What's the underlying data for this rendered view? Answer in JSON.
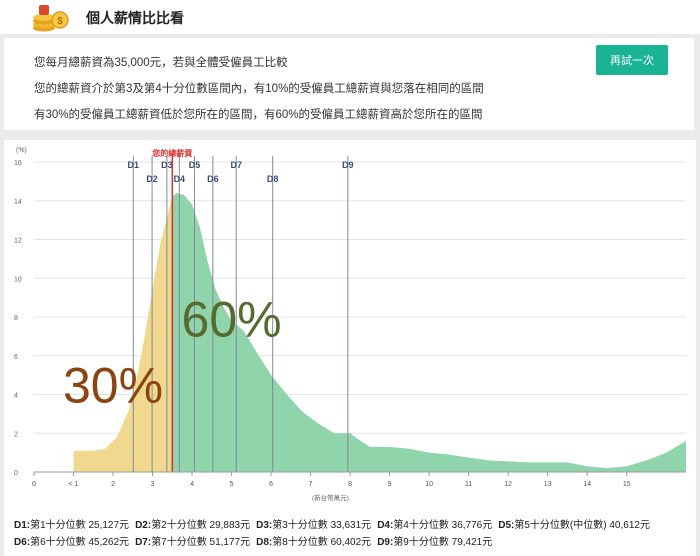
{
  "header": {
    "title": "個人薪情比比看"
  },
  "info": {
    "line1": "您每月總薪資為35,000元，若與全體受僱員工比較",
    "line2": "您的總薪資介於第3及第4十分位數區間內，有10%的受僱員工總薪資與您落在相同的區間",
    "line3": "有30%的受僱員工總薪資低於您所在的區間，有60%的受僱員工總薪資高於您所在的區間",
    "retry_label": "再試一次"
  },
  "chart_data": {
    "type": "area",
    "y_unit_label": "(%)",
    "x_unit_label": "(新台幣萬元)",
    "xlim": [
      0,
      16.5
    ],
    "ylim": [
      0,
      16
    ],
    "x_tick_labels": [
      "0",
      "< 1",
      "2",
      "3",
      "4",
      "5",
      "6",
      "7",
      "8",
      "9",
      "10",
      "11",
      "12",
      "13",
      "14",
      "15"
    ],
    "y_ticks": [
      0,
      2,
      4,
      6,
      8,
      10,
      12,
      14,
      16
    ],
    "grid": true,
    "series": [
      {
        "x": [
          1.0,
          1.5,
          1.8,
          2.1,
          2.4,
          2.6,
          2.8,
          3.0,
          3.2,
          3.35,
          3.5,
          3.6,
          3.8,
          4.0,
          4.2,
          4.4,
          4.6,
          4.8,
          5.0,
          5.3,
          5.6,
          6.0,
          6.4,
          6.8,
          7.2,
          7.6,
          7.8,
          8.0,
          8.2,
          8.5,
          9.0,
          9.5,
          10.0,
          10.5,
          11.0,
          11.5,
          12.0,
          12.5,
          13.0,
          13.5,
          14.0,
          14.5,
          15.0,
          15.5,
          16.0,
          16.5
        ],
        "y": [
          1.1,
          1.1,
          1.2,
          1.8,
          3.2,
          4.8,
          7.0,
          9.5,
          11.8,
          13.0,
          14.2,
          14.4,
          14.3,
          13.8,
          12.6,
          10.8,
          9.4,
          8.5,
          7.8,
          7.3,
          6.3,
          5.0,
          4.0,
          3.1,
          2.5,
          2.0,
          2.0,
          2.0,
          1.7,
          1.3,
          1.3,
          1.2,
          1.0,
          0.9,
          0.75,
          0.6,
          0.55,
          0.5,
          0.5,
          0.5,
          0.3,
          0.2,
          0.3,
          0.6,
          1.0,
          1.6
        ]
      }
    ],
    "split_x": 3.5,
    "user_salary_x": 3.5,
    "user_salary_label": "您的總薪資",
    "deciles": [
      {
        "label": "D1",
        "x": 2.5127
      },
      {
        "label": "D2",
        "x": 2.9883
      },
      {
        "label": "D3",
        "x": 3.3631
      },
      {
        "label": "D4",
        "x": 3.6776
      },
      {
        "label": "D5",
        "x": 4.0612
      },
      {
        "label": "D6",
        "x": 4.5262
      },
      {
        "label": "D7",
        "x": 5.1177
      },
      {
        "label": "D8",
        "x": 6.0402
      },
      {
        "label": "D9",
        "x": 7.9421
      }
    ],
    "annotations": [
      {
        "text": "30%",
        "color": "#8b4513"
      },
      {
        "text": "60%",
        "color": "#556b2f"
      }
    ],
    "colors": {
      "lower": "#f0d98e",
      "upper": "#8fd4ab",
      "line": "#7d8b99",
      "user": "#e0302a"
    }
  },
  "legend": {
    "row1": [
      {
        "key": "D1:",
        "text": "第1十分位數 25,127元"
      },
      {
        "key": "D2:",
        "text": "第2十分位數 29,883元"
      },
      {
        "key": "D3:",
        "text": "第3十分位數 33,631元"
      },
      {
        "key": "D4:",
        "text": "第4十分位數 36,776元"
      },
      {
        "key": "D5:",
        "text": "第5十分位數(中位數) 40,612元"
      }
    ],
    "row2": [
      {
        "key": "D6:",
        "text": "第6十分位數 45,262元"
      },
      {
        "key": "D7:",
        "text": "第7十分位數 51,177元"
      },
      {
        "key": "D8:",
        "text": "第8十分位數 60,402元"
      },
      {
        "key": "D9:",
        "text": "第9十分位數 79,421元"
      }
    ]
  }
}
